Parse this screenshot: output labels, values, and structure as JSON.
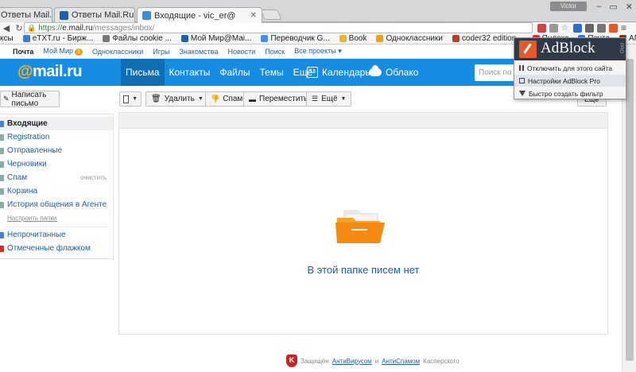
{
  "browser": {
    "tabs": [
      {
        "label": "Ответы Mail.Ru",
        "active": false
      },
      {
        "label": "Ответы Mail.Ru: Chr",
        "active": false
      },
      {
        "label": "Входящие - vic_er@",
        "active": true
      }
    ],
    "user_chip": "Victor",
    "url_scheme": "https://",
    "url_host": "e.mail.ru",
    "url_path": "/messages/inbox/"
  },
  "bookmarks": [
    {
      "label": "ксы",
      "color": "#999999"
    },
    {
      "label": "eTXT.ru - Бирж...",
      "color": "#3a7bd5"
    },
    {
      "label": "Файлы cookie ...",
      "color": "#777777"
    },
    {
      "label": "Мой Мир@Mai...",
      "color": "#1d5fa8"
    },
    {
      "label": "Переводчик G...",
      "color": "#4a8af4"
    },
    {
      "label": "Book",
      "color": "#e8b43a"
    },
    {
      "label": "Одноклассники",
      "color": "#f39d1a"
    },
    {
      "label": "coder32 edition...",
      "color": "#c0392b"
    },
    {
      "label": "Яндекс",
      "color": "#d63030"
    },
    {
      "label": "Почта",
      "color": "#3a7bd5"
    },
    {
      "label": "ANNO Онла",
      "color": "#7a3a1a"
    }
  ],
  "portal": {
    "items": [
      "Почта",
      "Мой Мир",
      "Одноклассники",
      "Игры",
      "Знакомства",
      "Новости",
      "Поиск",
      "Все проекты ▾"
    ],
    "badge": "1"
  },
  "mail": {
    "logo_at": "@",
    "logo_text": "mail.ru",
    "nav": [
      "Письма",
      "Контакты",
      "Файлы",
      "Темы",
      "Ещё"
    ],
    "calendar_label": "Календарь",
    "calendar_day": "13",
    "cloud_label": "Облако",
    "search_placeholder": "Поиск по почте"
  },
  "actions": {
    "compose": "Написать письмо",
    "delete": "Удалить",
    "spam": "Спам",
    "move": "Переместить",
    "more": "Ещё",
    "sort": "Ещё"
  },
  "folders": [
    {
      "label": "Входящие",
      "active": true
    },
    {
      "label": "Registration"
    },
    {
      "label": "Отправленные"
    },
    {
      "label": "Черновики"
    },
    {
      "label": "Спам",
      "extra": "очистить"
    },
    {
      "label": "Корзина"
    },
    {
      "label": "История общения в Агенте"
    }
  ],
  "folder_settings": "Настроить папки",
  "filters": [
    "Непрочитанные",
    "Отмеченные флажком"
  ],
  "empty_message": "В этой папке писем нет",
  "footer": {
    "prefix": "Защищён",
    "link1": "АнтиВирусом",
    "and": "и",
    "link2": "АнтиСпамом",
    "suffix": "Касперского"
  },
  "adblock": {
    "title": "AdBlock",
    "pro": "PRO",
    "items": [
      "Отключить для этого сайта",
      "Настройки AdBlock Pro",
      "Быстро создать фильтр"
    ]
  },
  "colors": {
    "mail_blue": "#168de2",
    "accent_orange": "#ffb31a",
    "link_blue": "#1d5fa8"
  }
}
